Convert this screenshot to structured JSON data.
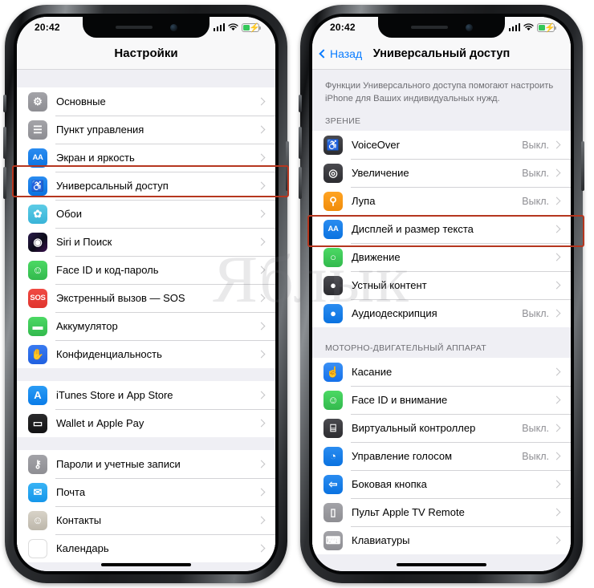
{
  "statusbar": {
    "time": "20:42",
    "signal_icon": "cellular-bars-icon",
    "wifi_icon": "wifi-icon",
    "battery_icon": "battery-charging-icon"
  },
  "watermark": {
    "text": "Яблык"
  },
  "left_phone": {
    "nav": {
      "title": "Настройки"
    },
    "groups": [
      {
        "rows": [
          {
            "label": "Основные",
            "icon": "gear-icon",
            "icon_class": "ic-gear",
            "glyph": "⚙",
            "value": ""
          },
          {
            "label": "Пункт управления",
            "icon": "sliders-icon",
            "icon_class": "ic-control",
            "glyph": "☰",
            "value": ""
          },
          {
            "label": "Экран и яркость",
            "icon": "display-aa-icon",
            "icon_class": "ic-display",
            "glyph": "AA",
            "value": ""
          },
          {
            "label": "Универсальный доступ",
            "icon": "accessibility-icon",
            "icon_class": "ic-access",
            "glyph": "♿",
            "value": "",
            "highlighted": true
          },
          {
            "label": "Обои",
            "icon": "wallpaper-icon",
            "icon_class": "ic-wallpaper",
            "glyph": "✿",
            "value": ""
          },
          {
            "label": "Siri и Поиск",
            "icon": "siri-icon",
            "icon_class": "ic-siri",
            "glyph": "◉",
            "value": ""
          },
          {
            "label": "Face ID и код-пароль",
            "icon": "faceid-icon",
            "icon_class": "ic-faceid",
            "glyph": "☺",
            "value": ""
          },
          {
            "label": "Экстренный вызов — SOS",
            "icon": "sos-icon",
            "icon_class": "ic-sos",
            "glyph": "SOS",
            "value": ""
          },
          {
            "label": "Аккумулятор",
            "icon": "battery-icon",
            "icon_class": "ic-battery",
            "glyph": "▬",
            "value": ""
          },
          {
            "label": "Конфиденциальность",
            "icon": "hand-privacy-icon",
            "icon_class": "ic-privacy",
            "glyph": "✋",
            "value": ""
          }
        ]
      },
      {
        "rows": [
          {
            "label": "iTunes Store и App Store",
            "icon": "app-store-icon",
            "icon_class": "ic-appstore",
            "glyph": "A",
            "value": ""
          },
          {
            "label": "Wallet и Apple Pay",
            "icon": "wallet-icon",
            "icon_class": "ic-wallet",
            "glyph": "▭",
            "value": ""
          }
        ]
      },
      {
        "rows": [
          {
            "label": "Пароли и учетные записи",
            "icon": "key-icon",
            "icon_class": "ic-passwords",
            "glyph": "⚷",
            "value": ""
          },
          {
            "label": "Почта",
            "icon": "mail-icon",
            "icon_class": "ic-mail",
            "glyph": "✉",
            "value": ""
          },
          {
            "label": "Контакты",
            "icon": "contacts-icon",
            "icon_class": "ic-contacts",
            "glyph": "☺",
            "value": ""
          },
          {
            "label": "Календарь",
            "icon": "calendar-icon",
            "icon_class": "ic-calendar",
            "glyph": "",
            "value": ""
          }
        ]
      }
    ]
  },
  "right_phone": {
    "nav": {
      "back_label": "Назад",
      "title": "Универсальный доступ"
    },
    "intro": "Функции Универсального доступа помогают настроить iPhone для Ваших индивидуальных нужд.",
    "sections": [
      {
        "header": "ЗРЕНИЕ",
        "rows": [
          {
            "label": "VoiceOver",
            "icon": "voiceover-icon",
            "icon_class": "ic-voiceover",
            "glyph": "♿",
            "value": "Выкл."
          },
          {
            "label": "Увеличение",
            "icon": "zoom-icon",
            "icon_class": "ic-zoom",
            "glyph": "◎",
            "value": "Выкл."
          },
          {
            "label": "Лупа",
            "icon": "magnifier-icon",
            "icon_class": "ic-magnifier",
            "glyph": "⚲",
            "value": "Выкл."
          },
          {
            "label": "Дисплей и размер текста",
            "icon": "display-aa-icon",
            "icon_class": "ic-display",
            "glyph": "AA",
            "value": "",
            "highlighted": true
          },
          {
            "label": "Движение",
            "icon": "motion-icon",
            "icon_class": "ic-motion",
            "glyph": "○",
            "value": ""
          },
          {
            "label": "Устный контент",
            "icon": "spoken-icon",
            "icon_class": "ic-spoken",
            "glyph": "●",
            "value": ""
          },
          {
            "label": "Аудиодескрипция",
            "icon": "audio-desc-icon",
            "icon_class": "ic-audiodesc",
            "glyph": "●",
            "value": "Выкл."
          }
        ]
      },
      {
        "header": "МОТОРНО-ДВИГАТЕЛЬНЫЙ АППАРАТ",
        "rows": [
          {
            "label": "Касание",
            "icon": "touch-icon",
            "icon_class": "ic-touch",
            "glyph": "☝",
            "value": ""
          },
          {
            "label": "Face ID и внимание",
            "icon": "faceid-icon",
            "icon_class": "ic-faceattn",
            "glyph": "☺",
            "value": ""
          },
          {
            "label": "Виртуальный контроллер",
            "icon": "switch-ctrl-icon",
            "icon_class": "ic-switch",
            "glyph": "⌸",
            "value": "Выкл."
          },
          {
            "label": "Управление голосом",
            "icon": "voice-ctrl-icon",
            "icon_class": "ic-voicectl",
            "glyph": "◔",
            "value": "Выкл."
          },
          {
            "label": "Боковая кнопка",
            "icon": "side-button-icon",
            "icon_class": "ic-sidebtn",
            "glyph": "⇦",
            "value": ""
          },
          {
            "label": "Пульт Apple TV Remote",
            "icon": "apple-tv-remote-icon",
            "icon_class": "ic-appletv",
            "glyph": "▯",
            "value": ""
          },
          {
            "label": "Клавиатуры",
            "icon": "keyboard-icon",
            "icon_class": "ic-keyboard",
            "glyph": "⌨",
            "value": ""
          }
        ]
      }
    ]
  }
}
